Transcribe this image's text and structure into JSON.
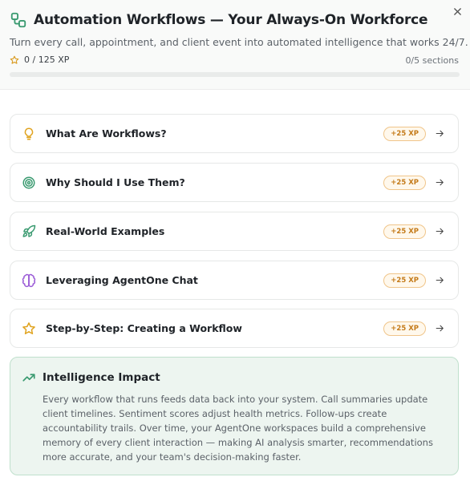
{
  "header": {
    "title": "Automation Workflows — Your Always-On Workforce",
    "subtitle": "Turn every call, appointment, and client event into automated intelligence that works 24/7.",
    "xp": "0 / 125 XP",
    "sections": "0/5 sections",
    "progress_fraction": 0
  },
  "colors": {
    "accent": "#3a9a70",
    "badge": "#c47a18",
    "impact_bg": "#edf5f0"
  },
  "cards": [
    {
      "label": "What Are Workflows?",
      "xp": "+25 XP",
      "icon": "lightbulb-icon"
    },
    {
      "label": "Why Should I Use Them?",
      "xp": "+25 XP",
      "icon": "target-icon"
    },
    {
      "label": "Real-World Examples",
      "xp": "+25 XP",
      "icon": "rocket-icon"
    },
    {
      "label": "Leveraging AgentOne Chat",
      "xp": "+25 XP",
      "icon": "brain-icon"
    },
    {
      "label": "Step-by-Step: Creating a Workflow",
      "xp": "+25 XP",
      "icon": "star-icon"
    }
  ],
  "impact": {
    "title": "Intelligence Impact",
    "body": "Every workflow that runs feeds data back into your system. Call summaries update client timelines. Sentiment scores adjust health metrics. Follow-ups create accountability trails. Over time, your AgentOne workspaces build a comprehensive memory of every client interaction — making AI analysis smarter, recommendations more accurate, and your team's decision-making faster."
  }
}
